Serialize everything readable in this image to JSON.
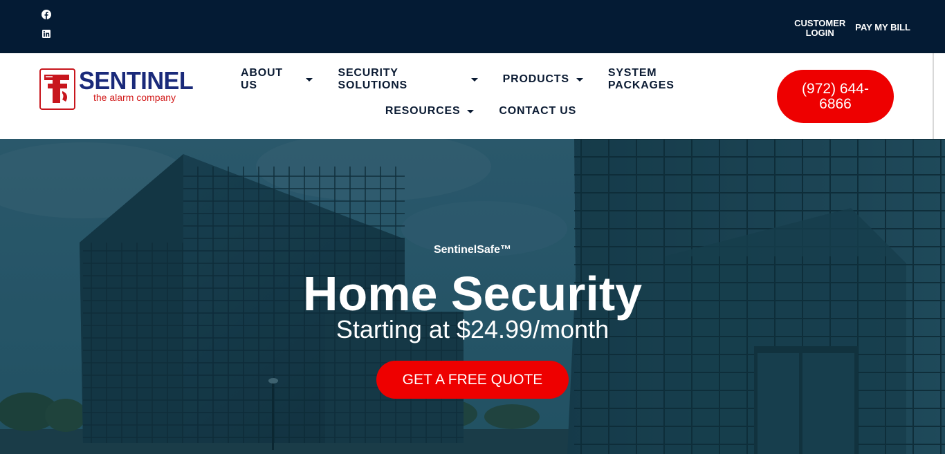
{
  "topbar": {
    "social": [
      {
        "icon": "facebook-icon"
      },
      {
        "icon": "linkedin-icon"
      }
    ],
    "customer_login_line1": "CUSTOMER",
    "customer_login_line2": "LOGIN",
    "pay_bill": "PAY MY BILL",
    "bg_color": "#041b34"
  },
  "header": {
    "logo": {
      "name": "SENTINEL",
      "tagline": "the alarm company",
      "name_color": "#1a2a7a",
      "accent_color": "#d21a1a"
    },
    "nav_row1": [
      {
        "label": "ABOUT US",
        "dropdown": true
      },
      {
        "label": "SECURITY SOLUTIONS",
        "dropdown": true
      },
      {
        "label": "PRODUCTS",
        "dropdown": true
      },
      {
        "label": "SYSTEM PACKAGES",
        "dropdown": false
      }
    ],
    "nav_row2": [
      {
        "label": "RESOURCES",
        "dropdown": true
      },
      {
        "label": "CONTACT US",
        "dropdown": false
      }
    ],
    "phone": "(972) 644-6866",
    "phone_color": "#ee0000"
  },
  "hero": {
    "eyebrow": "SentinelSafe™",
    "title": "Home Security",
    "subtitle": "Starting at $24.99/month",
    "cta": "GET A FREE QUOTE",
    "cta_color": "#ee0000"
  }
}
